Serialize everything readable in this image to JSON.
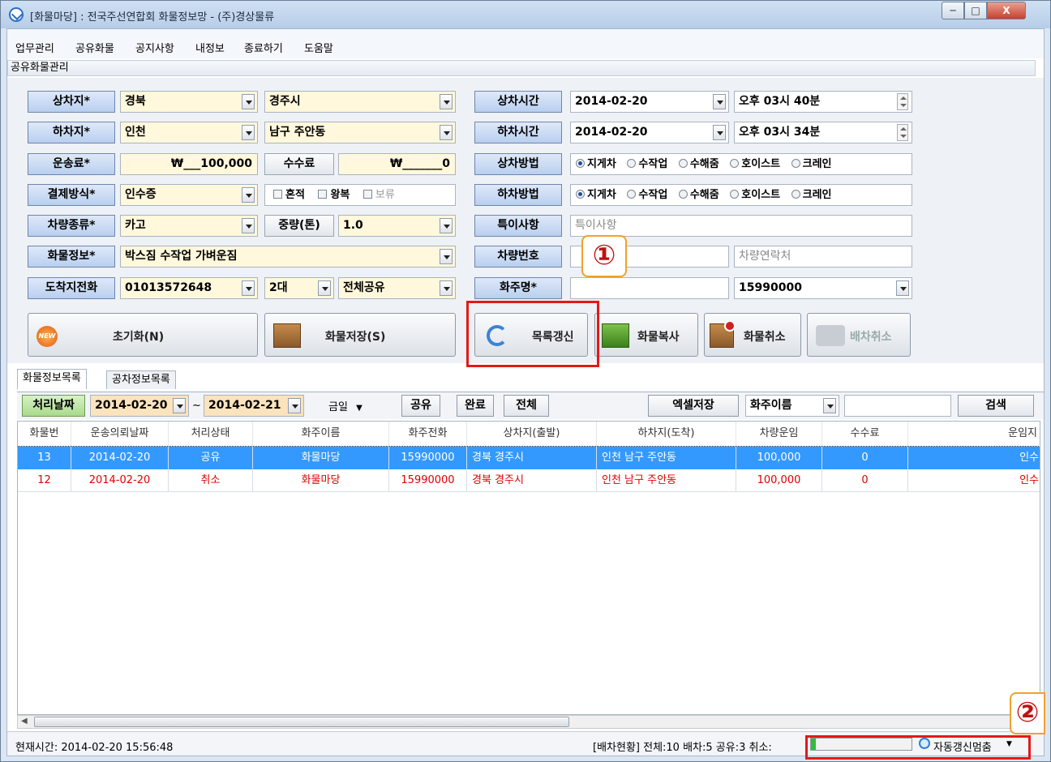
{
  "window": {
    "title": "[화물마당] : 전국주선연합회 화물정보망 - (주)경상물류",
    "min_label": "─",
    "max_label": "□",
    "close_label": "X"
  },
  "menu": [
    "업무관리",
    "공유화물",
    "공지사항",
    "내정보",
    "종료하기",
    "도움말"
  ],
  "group_title": "공유화물관리",
  "form": {
    "load_place": {
      "label": "상차지*",
      "province": "경북",
      "city": "경주시"
    },
    "unload_place": {
      "label": "하차지*",
      "province": "인천",
      "city": "남구 주안동"
    },
    "fare": {
      "label": "운송료*",
      "value": "₩___100,000",
      "fee_label": "수수료",
      "fee_value": "₩_______0"
    },
    "payment": {
      "label": "결제방식*",
      "value": "인수증",
      "checks": [
        "혼적",
        "왕복",
        "보류"
      ]
    },
    "vehicle_type": {
      "label": "차량종류*",
      "value": "카고",
      "weight_label": "중량(톤)",
      "weight_value": "1.0"
    },
    "cargo_info": {
      "label": "화물정보*",
      "value": "박스짐 수작업 가벼운짐"
    },
    "arrival_phone": {
      "label": "도착지전화",
      "value": "01013572648",
      "count": "2대",
      "share": "전체공유"
    },
    "load_time": {
      "label": "상차시간",
      "date": "2014-02-20",
      "time": "오후 03시 40분"
    },
    "unload_time": {
      "label": "하차시간",
      "date": "2014-02-20",
      "time": "오후 03시 34분"
    },
    "load_method": {
      "label": "상차방법",
      "options": [
        "지게차",
        "수작업",
        "수해줌",
        "호이스트",
        "크레인"
      ],
      "selected": "지게차"
    },
    "unload_method": {
      "label": "하차방법",
      "options": [
        "지게차",
        "수작업",
        "수해줌",
        "호이스트",
        "크레인"
      ],
      "selected": "지게차"
    },
    "special": {
      "label": "특이사항",
      "placeholder": "특이사항"
    },
    "vehicle_no": {
      "label": "차량번호",
      "contact_placeholder": "차량연락처"
    },
    "shipper": {
      "label": "화주명*",
      "phone": "15990000"
    }
  },
  "actions": {
    "reset": "초기화(N)",
    "save": "화물저장(S)",
    "refresh": "목록갱신",
    "copy": "화물복사",
    "cancel": "화물취소",
    "dispatch_cancel": "배차취소",
    "new_badge": "NEW"
  },
  "callouts": [
    "①",
    "②"
  ],
  "tabs": [
    "화물정보목록",
    "공차정보목록"
  ],
  "toolbar": {
    "date_label": "처리날짜",
    "from": "2014-02-20",
    "tilde": "~",
    "to": "2014-02-21",
    "today": "금일",
    "share": "공유",
    "done": "완료",
    "all": "전체",
    "excel": "엑셀저장",
    "search_field": "화주이름",
    "search": "검색"
  },
  "table": {
    "columns": [
      "화물번",
      "운송의뢰날짜",
      "처리상태",
      "화주이름",
      "화주전화",
      "상차지(출발)",
      "하차지(도착)",
      "차량운임",
      "수수료",
      "운임지"
    ],
    "rows": [
      [
        "13",
        "2014-02-20",
        "공유",
        "화물마당",
        "15990000",
        "경북 경주시",
        "인천 남구 주안동",
        "100,000",
        "0",
        "인수"
      ],
      [
        "12",
        "2014-02-20",
        "취소",
        "화물마당",
        "15990000",
        "경북 경주시",
        "인천 남구 주안동",
        "100,000",
        "0",
        "인수"
      ]
    ]
  },
  "status": {
    "time": "현재시간:  2014-02-20 15:56:48",
    "summary": "[배차현황]  전체:10  배차:5  공유:3  취소:",
    "auto": "자동갱신멈춤",
    "progress": 0.05
  },
  "colors": {
    "selected_row": "#3399ff",
    "cancel_text": "#e00000",
    "highlight": "#e31919",
    "label_blue": "#b9cff0"
  }
}
